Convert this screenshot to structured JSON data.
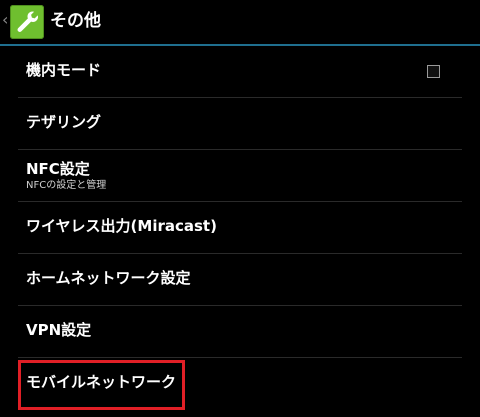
{
  "actionbar": {
    "title": "その他",
    "back_icon": "chevron-left-icon",
    "app_icon": "wrench-icon",
    "accent_color": "#1f6f8f",
    "icon_color": "#6fbf2f"
  },
  "list": {
    "items": [
      {
        "label": "機内モード",
        "has_checkbox": true,
        "checked": false
      },
      {
        "label": "テザリング"
      },
      {
        "label": "NFC設定",
        "summary": "NFCの設定と管理"
      },
      {
        "label": "ワイヤレス出力(Miracast)"
      },
      {
        "label": "ホームネットワーク設定"
      },
      {
        "label": "VPN設定"
      },
      {
        "label": "モバイルネットワーク",
        "highlight_color": "#e01f26"
      }
    ]
  }
}
